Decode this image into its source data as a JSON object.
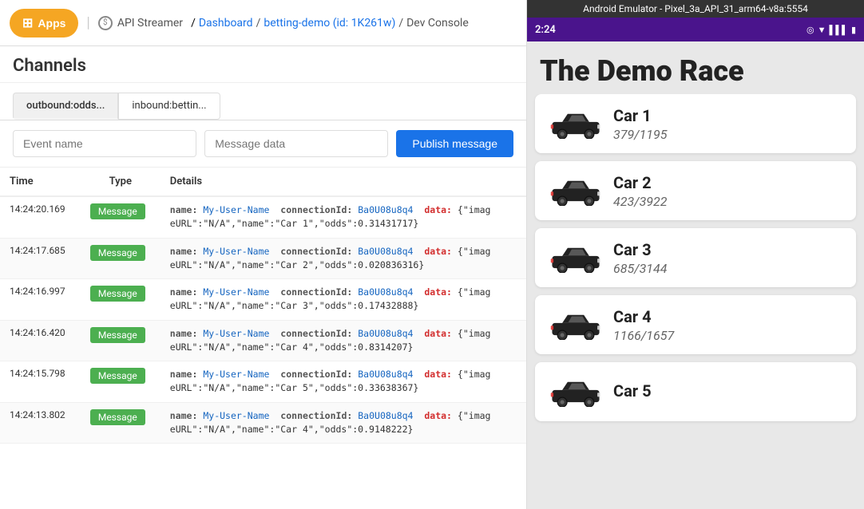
{
  "nav": {
    "apps_label": "Apps",
    "api_streamer_label": "API Streamer",
    "breadcrumb": {
      "dashboard": "Dashboard",
      "demo": "betting-demo (id: 1K261w)",
      "current": "Dev Console"
    }
  },
  "page": {
    "title": "Channels"
  },
  "tabs": [
    {
      "label": "outbound:odds...",
      "active": true
    },
    {
      "label": "inbound:bettin...",
      "active": false
    }
  ],
  "publish": {
    "event_placeholder": "Event name",
    "message_placeholder": "Message data",
    "button_label": "Publish message"
  },
  "table": {
    "headers": [
      "Time",
      "Type",
      "Details"
    ],
    "rows": [
      {
        "time": "14:24:20.169",
        "type": "Message",
        "name_key": "name:",
        "name_val": "My-User-Name",
        "conn_key": "connectionId:",
        "conn_val": "Ba0U08u8q4",
        "data_key": "data:",
        "data_val": "{\"imag",
        "detail2": "eURL\":\"N/A\",\"name\":\"Car 1\",\"odds\":0.31431717}"
      },
      {
        "time": "14:24:17.685",
        "type": "Message",
        "name_key": "name:",
        "name_val": "My-User-Name",
        "conn_key": "connectionId:",
        "conn_val": "Ba0U08u8q4",
        "data_key": "data:",
        "data_val": "{\"imag",
        "detail2": "eURL\":\"N/A\",\"name\":\"Car 2\",\"odds\":0.020836316}"
      },
      {
        "time": "14:24:16.997",
        "type": "Message",
        "name_key": "name:",
        "name_val": "My-User-Name",
        "conn_key": "connectionId:",
        "conn_val": "Ba0U08u8q4",
        "data_key": "data:",
        "data_val": "{\"imag",
        "detail2": "eURL\":\"N/A\",\"name\":\"Car 3\",\"odds\":0.17432888}"
      },
      {
        "time": "14:24:16.420",
        "type": "Message",
        "name_key": "name:",
        "name_val": "My-User-Name",
        "conn_key": "connectionId:",
        "conn_val": "Ba0U08u8q4",
        "data_key": "data:",
        "data_val": "{\"imag",
        "detail2": "eURL\":\"N/A\",\"name\":\"Car 4\",\"odds\":0.8314207}"
      },
      {
        "time": "14:24:15.798",
        "type": "Message",
        "name_key": "name:",
        "name_val": "My-User-Name",
        "conn_key": "connectionId:",
        "conn_val": "Ba0U08u8q4",
        "data_key": "data:",
        "data_val": "{\"imag",
        "detail2": "eURL\":\"N/A\",\"name\":\"Car 5\",\"odds\":0.33638367}"
      },
      {
        "time": "14:24:13.802",
        "type": "Message",
        "name_key": "name:",
        "name_val": "My-User-Name",
        "conn_key": "connectionId:",
        "conn_val": "Ba0U08u8q4",
        "data_key": "data:",
        "data_val": "{\"imag",
        "detail2": "eURL\":\"N/A\",\"name\":\"Car 4\",\"odds\":0.9148222}"
      }
    ]
  },
  "emulator": {
    "title": "Android Emulator - Pixel_3a_API_31_arm64-v8a:5554",
    "time": "2:24",
    "race_title": "The Demo Race",
    "cars": [
      {
        "name": "Car 1",
        "score": "379/1195"
      },
      {
        "name": "Car 2",
        "score": "423/3922"
      },
      {
        "name": "Car 3",
        "score": "685/3144"
      },
      {
        "name": "Car 4",
        "score": "1166/1657"
      },
      {
        "name": "Car 5",
        "score": ""
      }
    ]
  }
}
